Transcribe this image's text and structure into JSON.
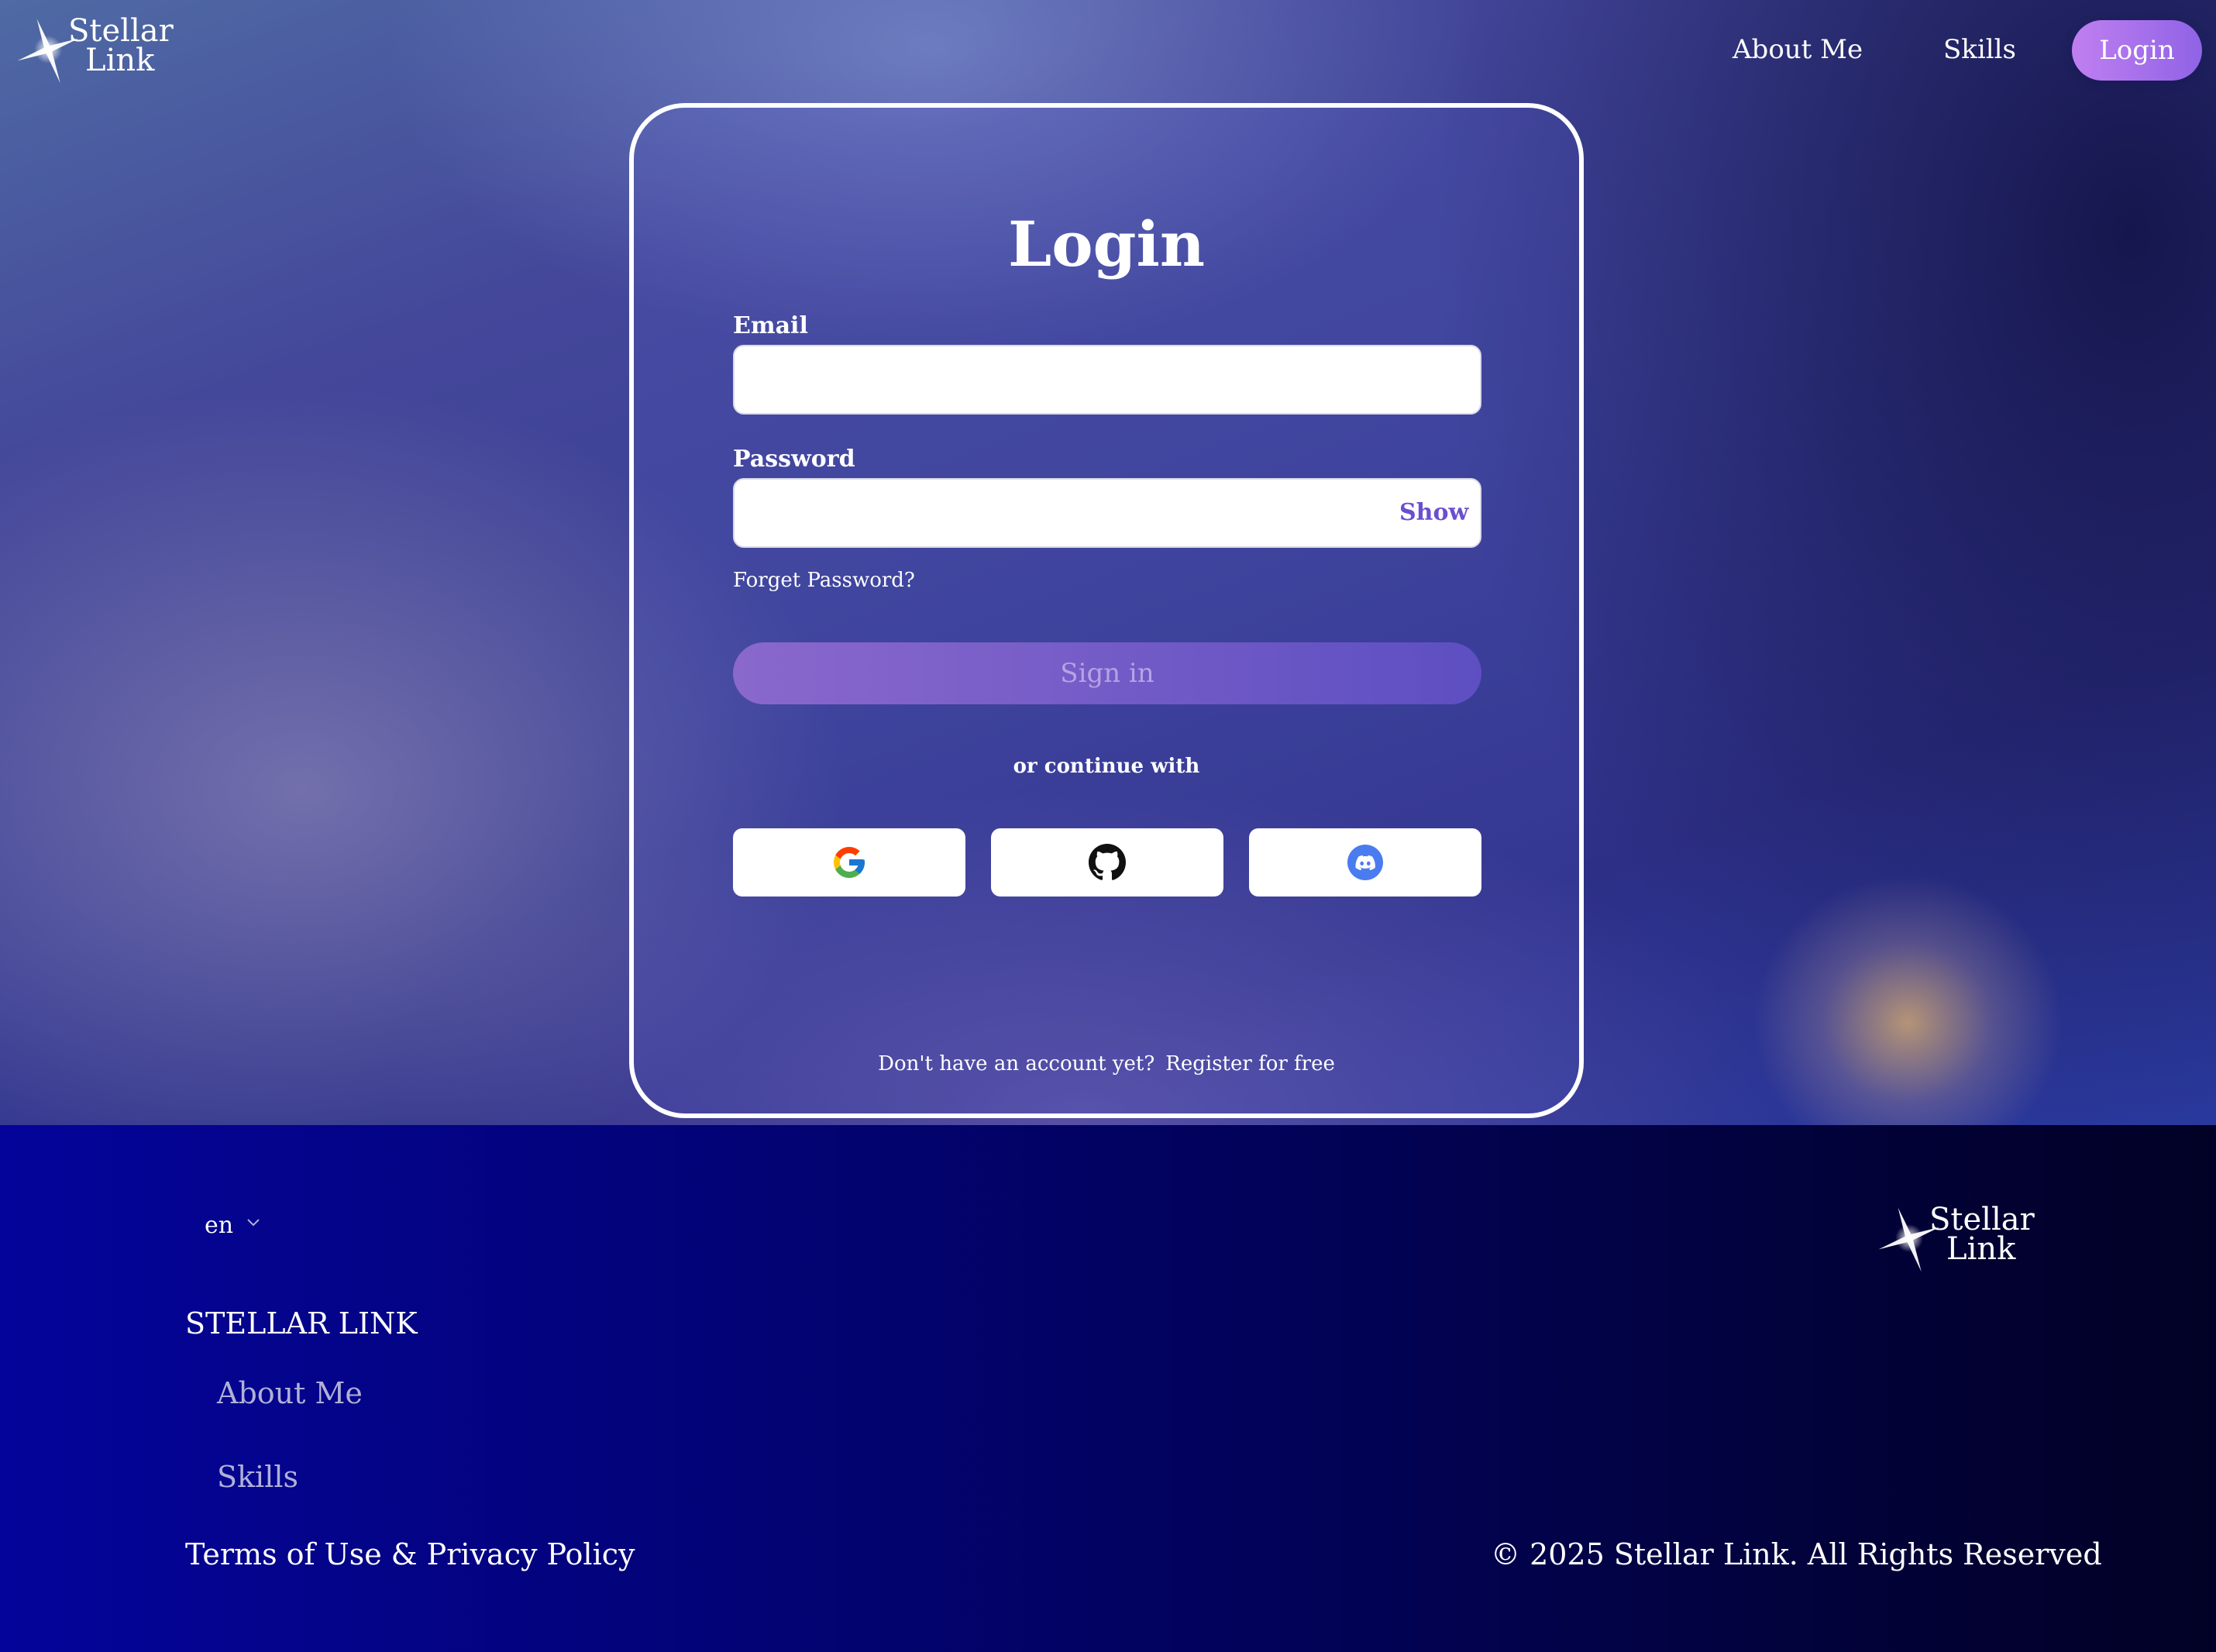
{
  "logo": {
    "line1": "Stellar",
    "line2": "Link"
  },
  "nav": {
    "about": "About Me",
    "skills": "Skills",
    "login": "Login"
  },
  "card": {
    "title": "Login",
    "email_label": "Email",
    "email_value": "",
    "password_label": "Password",
    "password_value": "",
    "show_label": "Show",
    "forgot": "Forget Password?",
    "signin": "Sign in",
    "or_text": "or continue with",
    "social": [
      "google-icon",
      "github-icon",
      "discord-icon"
    ],
    "no_account": "Don't have an account yet?",
    "register": "Register for free"
  },
  "footer": {
    "language": "en",
    "brand": "STELLAR LINK",
    "links": [
      "About Me",
      "Skills"
    ],
    "terms": "Terms of Use & Privacy Policy",
    "copyright": "© 2025 Stellar Link. All Rights Reserved"
  },
  "colors": {
    "accent": "#8f63e6",
    "show": "#6a4fd0",
    "footer_start": "#04049a",
    "footer_end": "#020125"
  }
}
